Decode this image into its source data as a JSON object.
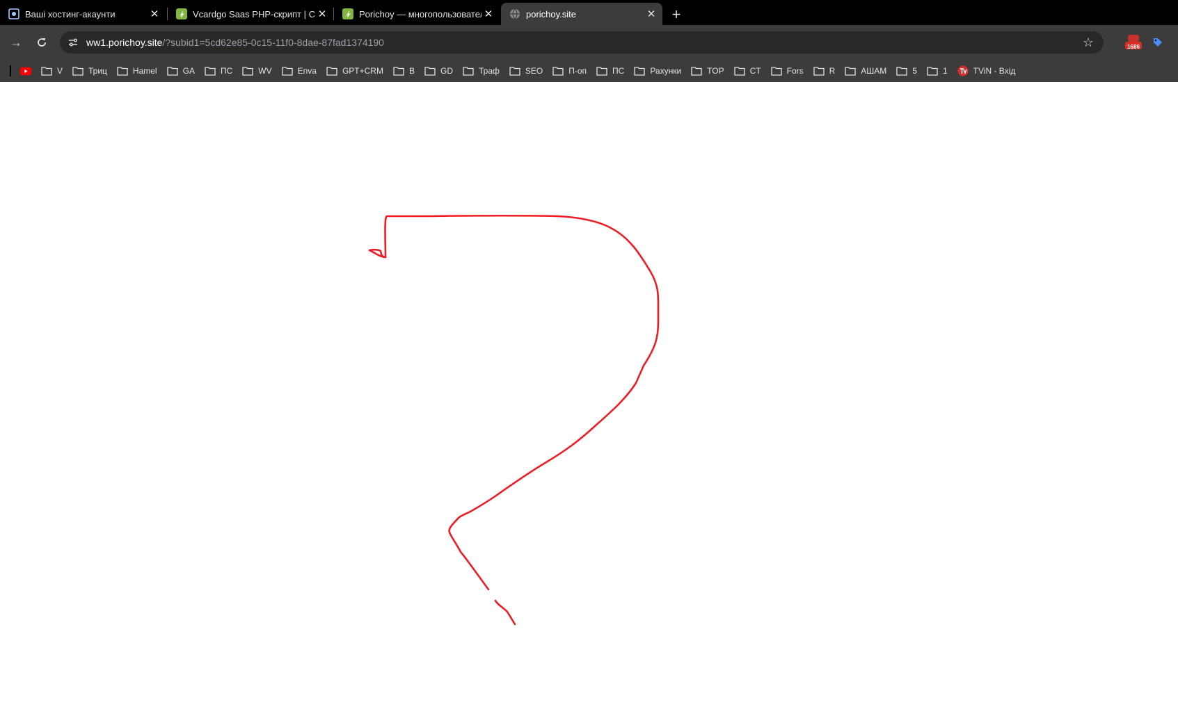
{
  "tabs": [
    {
      "title": "Ваші хостинг-акаунти",
      "icon": "hosting-icon",
      "active": false
    },
    {
      "title": "Vcardgo Saas PHP-скрипт | Coc",
      "icon": "envato-icon",
      "active": false
    },
    {
      "title": "Porichoy — многопользовател",
      "icon": "envato-icon",
      "active": false
    },
    {
      "title": "porichoy.site",
      "icon": "globe-icon",
      "active": true
    }
  ],
  "address_bar": {
    "host": "ww1.porichoy.site",
    "path": "/?subid1=5cd62e85-0c15-11f0-8dae-87fad1374190"
  },
  "extensions": {
    "badge_count": "1686"
  },
  "bookmarks": [
    {
      "label": "",
      "icon": "youtube-icon"
    },
    {
      "label": "V",
      "icon": "folder-icon"
    },
    {
      "label": "Триц",
      "icon": "folder-icon"
    },
    {
      "label": "Hamel",
      "icon": "folder-icon"
    },
    {
      "label": "GA",
      "icon": "folder-icon"
    },
    {
      "label": "ПС",
      "icon": "folder-icon"
    },
    {
      "label": "WV",
      "icon": "folder-icon"
    },
    {
      "label": "Enva",
      "icon": "folder-icon"
    },
    {
      "label": "GPT+CRM",
      "icon": "folder-icon"
    },
    {
      "label": "B",
      "icon": "folder-icon"
    },
    {
      "label": "GD",
      "icon": "folder-icon"
    },
    {
      "label": "Траф",
      "icon": "folder-icon"
    },
    {
      "label": "SEO",
      "icon": "folder-icon"
    },
    {
      "label": "П-оп",
      "icon": "folder-icon"
    },
    {
      "label": "ПС",
      "icon": "folder-icon"
    },
    {
      "label": "Рахунки",
      "icon": "folder-icon"
    },
    {
      "label": "TOP",
      "icon": "folder-icon"
    },
    {
      "label": "CT",
      "icon": "folder-icon"
    },
    {
      "label": "Fors",
      "icon": "folder-icon"
    },
    {
      "label": "R",
      "icon": "folder-icon"
    },
    {
      "label": "АШАМ",
      "icon": "folder-icon"
    },
    {
      "label": "5",
      "icon": "folder-icon"
    },
    {
      "label": "1",
      "icon": "folder-icon"
    },
    {
      "label": "TViN - Вхід",
      "icon": "tvin-icon"
    }
  ],
  "colors": {
    "annotation": "#ee1c24",
    "tabstrip": "#000000",
    "toolbar": "#3c3c3c",
    "omnibox": "#282828"
  }
}
